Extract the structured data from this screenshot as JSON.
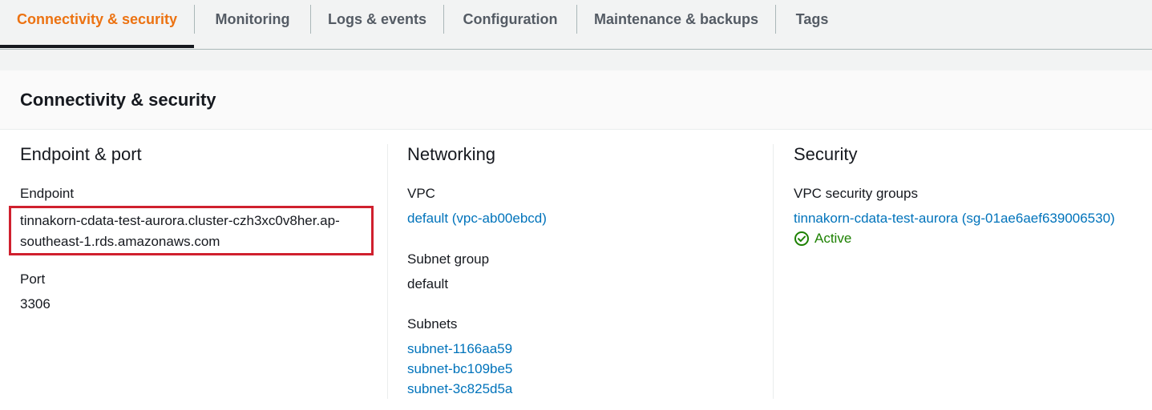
{
  "tabs": [
    {
      "label": "Connectivity & security",
      "active": true
    },
    {
      "label": "Monitoring"
    },
    {
      "label": "Logs & events"
    },
    {
      "label": "Configuration"
    },
    {
      "label": "Maintenance & backups"
    },
    {
      "label": "Tags"
    }
  ],
  "panel": {
    "title": "Connectivity & security"
  },
  "endpoint_port": {
    "title": "Endpoint & port",
    "endpoint_label": "Endpoint",
    "endpoint_value": "tinnakorn-cdata-test-aurora.cluster-czh3xc0v8her.ap-southeast-1.rds.amazonaws.com",
    "port_label": "Port",
    "port_value": "3306"
  },
  "networking": {
    "title": "Networking",
    "vpc_label": "VPC",
    "vpc_value": "default (vpc-ab00ebcd)",
    "subnet_group_label": "Subnet group",
    "subnet_group_value": "default",
    "subnets_label": "Subnets",
    "subnets": [
      "subnet-1166aa59",
      "subnet-bc109be5",
      "subnet-3c825d5a"
    ]
  },
  "security": {
    "title": "Security",
    "sg_label": "VPC security groups",
    "sg_value": "tinnakorn-cdata-test-aurora (sg-01ae6aef639006530)",
    "status_text": "Active",
    "status_icon": "check-circle-icon"
  },
  "colors": {
    "active_tab": "#ec7211",
    "link": "#0073bb",
    "success": "#1d8102",
    "highlight_box": "#d0202e"
  }
}
